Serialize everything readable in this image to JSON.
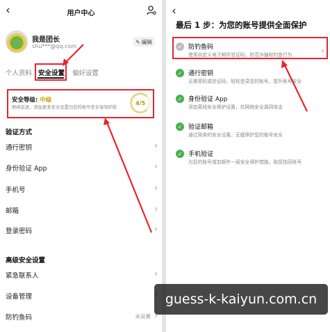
{
  "left": {
    "title": "用户中心",
    "back_glyph": "‹",
    "profile": {
      "name": "我是团长",
      "email": "shu***@qq.com",
      "edit_label": "编辑"
    },
    "tabs": [
      {
        "label": "个人资料",
        "active": false
      },
      {
        "label": "安全设置",
        "active": true
      },
      {
        "label": "偏好设置",
        "active": false
      }
    ],
    "security": {
      "title": "安全等级:",
      "level": "中级",
      "desc": "继续前进，添加更多安全设置为您的账号安全保驾护航",
      "score": "4/5"
    },
    "verify_header": "验证方式",
    "verify_items": [
      "通行密钥",
      "身份验证 App",
      "手机号",
      "邮箱",
      "登录密码"
    ],
    "advanced_header": "高级安全设置",
    "advanced_items": [
      {
        "label": "紧急联系人",
        "value": ""
      },
      {
        "label": "设备管理",
        "value": ""
      },
      {
        "label": "防钓鱼码",
        "value": "未设置"
      }
    ]
  },
  "right": {
    "back_glyph": "‹",
    "title": "最后 1 步：为您的账号提供全面保护",
    "steps": [
      {
        "title": "防钓鱼码",
        "desc": "使用自定义电子邮件验证码，防范诈骗和钓鱼行为",
        "done": false,
        "chevron": true
      },
      {
        "title": "通行密钥",
        "desc": "无需密码或验证码，轻松登录您的账号，提升账号安全",
        "done": true,
        "chevron": false
      },
      {
        "title": "身份验证 App",
        "desc": "添加离线安全保护设置，抗网络安全漏洞攻击",
        "done": true,
        "chevron": false
      },
      {
        "title": "验证邮箱",
        "desc": "通过简单的安全设置，无缝保护您的账号安全",
        "done": true,
        "chevron": false
      },
      {
        "title": "手机验证",
        "desc": "为您的账号增加额外一层安全保护措施，助您找回账号",
        "done": true,
        "chevron": false
      }
    ]
  },
  "watermark": "guess-k-kaiyun.com.cn",
  "colors": {
    "highlight": "#e8242c",
    "check_green": "#4caf50",
    "level_gold": "#c9a10a"
  }
}
